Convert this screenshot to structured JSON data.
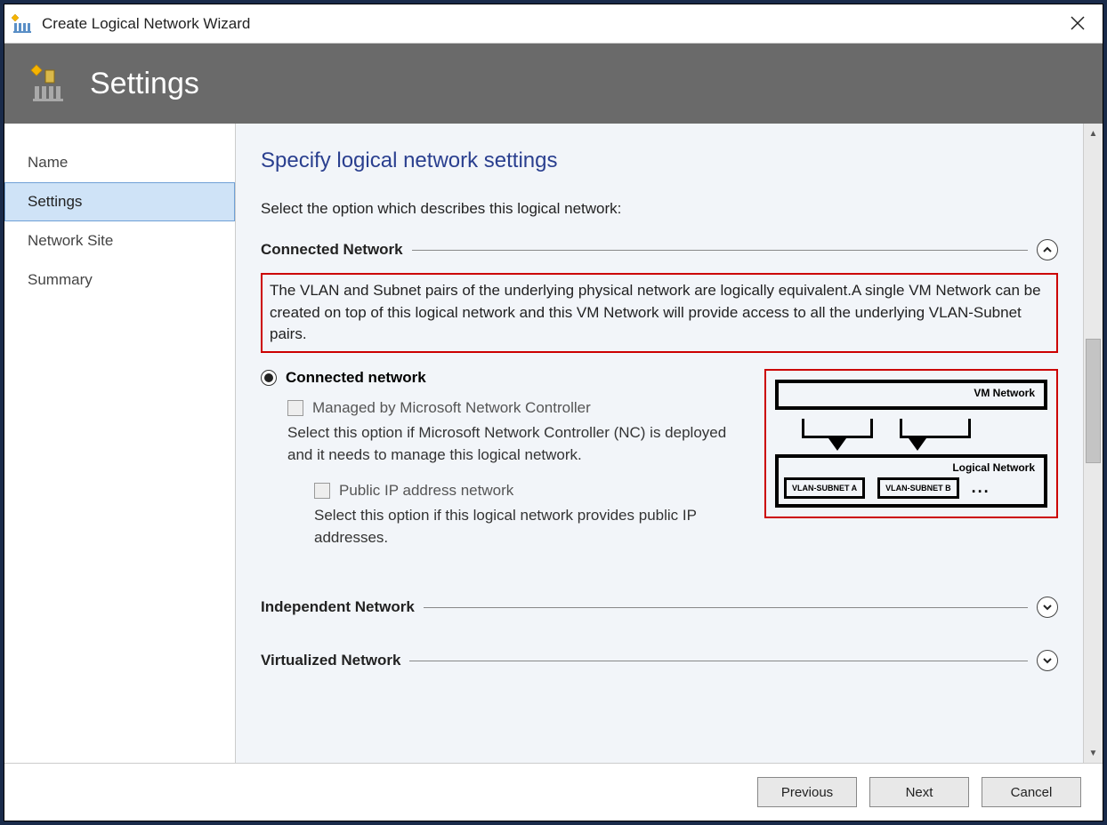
{
  "titlebar": {
    "title": "Create Logical Network Wizard"
  },
  "header": {
    "label": "Settings"
  },
  "sidebar": {
    "items": [
      {
        "label": "Name"
      },
      {
        "label": "Settings"
      },
      {
        "label": "Network Site"
      },
      {
        "label": "Summary"
      }
    ],
    "active_index": 1
  },
  "content": {
    "heading": "Specify logical network settings",
    "intro": "Select the option which describes this logical network:",
    "sections": {
      "connected": {
        "title": "Connected Network",
        "description": "The VLAN and Subnet pairs of the underlying physical network are logically equivalent.A single VM Network can be created on top of this logical network and this VM Network will provide access to all the underlying VLAN-Subnet pairs.",
        "radio_label": "Connected network",
        "check1_label": "Managed by Microsoft Network Controller",
        "check1_desc": "Select this option if Microsoft Network Controller (NC) is deployed and it needs to manage this logical network.",
        "check2_label": "Public IP address network",
        "check2_desc": "Select this option if this logical network provides public IP addresses."
      },
      "independent": {
        "title": "Independent Network"
      },
      "virtualized": {
        "title": "Virtualized Network"
      }
    },
    "diagram": {
      "vm_network": "VM Network",
      "logical_network": "Logical Network",
      "vlan_a": "VLAN-SUBNET A",
      "vlan_b": "VLAN-SUBNET B",
      "dots": "..."
    }
  },
  "buttons": {
    "previous": "Previous",
    "next": "Next",
    "cancel": "Cancel"
  }
}
